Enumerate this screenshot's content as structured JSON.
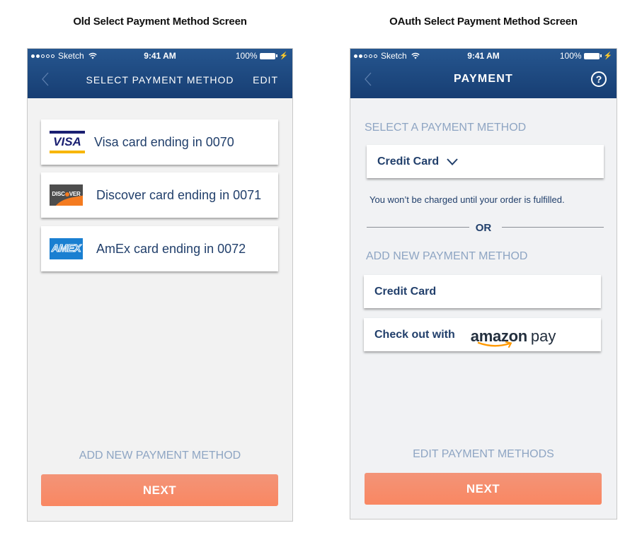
{
  "captions": {
    "left": "Old Select Payment Method Screen",
    "right": "OAuth Select Payment Method Screen"
  },
  "status_bar": {
    "carrier": "Sketch",
    "signal_bars_filled": 2,
    "signal_bars_total": 5,
    "time": "9:41 AM",
    "battery": "100%"
  },
  "old_screen": {
    "title": "SELECT PAYMENT METHOD",
    "edit_label": "EDIT",
    "cards": [
      {
        "brand": "VISA",
        "logo": "visa-logo",
        "label": "Visa card ending in 0070"
      },
      {
        "brand": "DISCOVER",
        "logo": "discover-logo",
        "label": "Discover card ending in 0071"
      },
      {
        "brand": "AMEX",
        "logo": "amex-logo",
        "label": "AmEx card ending in 0072"
      }
    ],
    "add_link": "ADD NEW PAYMENT METHOD",
    "next_label": "NEXT"
  },
  "oauth_screen": {
    "title": "PAYMENT",
    "help_label": "?",
    "select_section": "SELECT A PAYMENT METHOD",
    "selected_method": "Credit Card",
    "note": "You won’t be charged until your order is fulfilled.",
    "or_label": "OR",
    "add_section": "ADD NEW PAYMENT METHOD",
    "add_credit_card": "Credit Card",
    "checkout_with": "Check out with",
    "amazon_word": "amazon",
    "pay_word": "pay",
    "edit_link": "EDIT PAYMENT METHODS",
    "next_label": "NEXT"
  },
  "colors": {
    "header_top": "#26568f",
    "header_bottom": "#173e73",
    "text_navy": "#213f6b",
    "muted_link": "#8ea5c3",
    "next_button": "#f98762",
    "amazon_orange": "#ff9900"
  }
}
